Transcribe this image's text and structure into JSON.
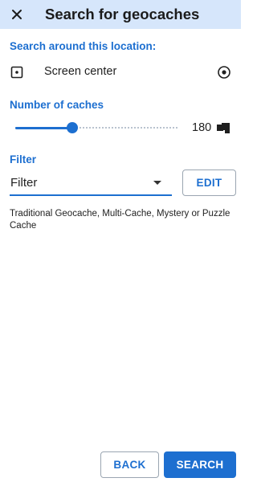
{
  "header": {
    "title": "Search for geocaches",
    "close_icon": "close-icon"
  },
  "location": {
    "label": "Search around this location:",
    "value": "Screen center",
    "leading_icon": "map-center-icon",
    "trailing_icon": "target-location-icon"
  },
  "caches": {
    "label": "Number of caches",
    "value": "180",
    "slider_fraction": 0.35,
    "count_icon": "cache-stack-icon"
  },
  "filter": {
    "label": "Filter",
    "selected": "Filter",
    "edit_label": "EDIT",
    "description": "Traditional Geocache, Multi-Cache, Mystery or Puzzle Cache"
  },
  "footer": {
    "back_label": "BACK",
    "search_label": "SEARCH"
  },
  "colors": {
    "accent": "#1d6fd0",
    "header_bg": "#d6e6fb"
  }
}
